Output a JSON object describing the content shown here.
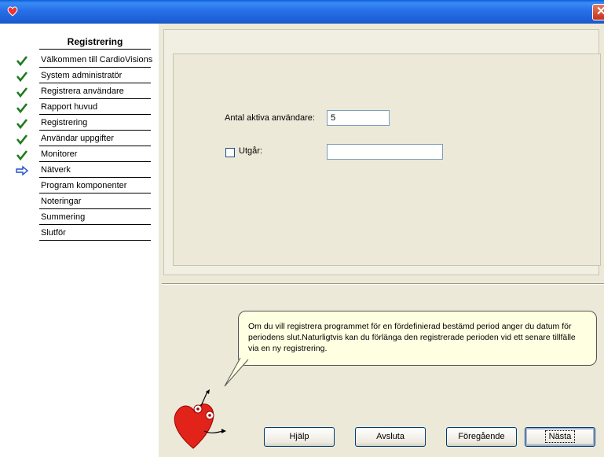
{
  "sidebar": {
    "title": "Registrering",
    "steps": [
      {
        "label": "Välkommen till CardioVisions",
        "status": "done"
      },
      {
        "label": "System administratör",
        "status": "done"
      },
      {
        "label": "Registrera användare",
        "status": "done"
      },
      {
        "label": "Rapport huvud",
        "status": "done"
      },
      {
        "label": "Registrering",
        "status": "done"
      },
      {
        "label": "Användar uppgifter",
        "status": "done"
      },
      {
        "label": "Monitorer",
        "status": "done"
      },
      {
        "label": "Nätverk",
        "status": "current"
      },
      {
        "label": "Program komponenter",
        "status": "pending"
      },
      {
        "label": "Noteringar",
        "status": "pending"
      },
      {
        "label": "Summering",
        "status": "pending"
      },
      {
        "label": "Slutför",
        "status": "pending"
      }
    ]
  },
  "form": {
    "active_users_label": "Antal aktiva användare:",
    "active_users_value": "5",
    "expires_label": "Utgår:",
    "expires_checked": false,
    "expires_value": ""
  },
  "help_bubble": {
    "text": "Om du vill registrera programmet för en fördefinierad bestämd period anger du datum för periodens slut.Naturligtvis kan du förlänga den registrerade perioden vid ett senare tillfälle via en ny registrering."
  },
  "buttons": {
    "help": "Hjälp",
    "cancel": "Avsluta",
    "back": "Föregående",
    "next": "Nästa"
  },
  "colors": {
    "done_check": "#1E7A1E",
    "current_arrow": "#1F4FC8",
    "titlebar": "#1D5FD6",
    "close": "#C4321A"
  },
  "icons": {
    "done": "checkmark-icon",
    "current": "arrow-right-icon"
  }
}
